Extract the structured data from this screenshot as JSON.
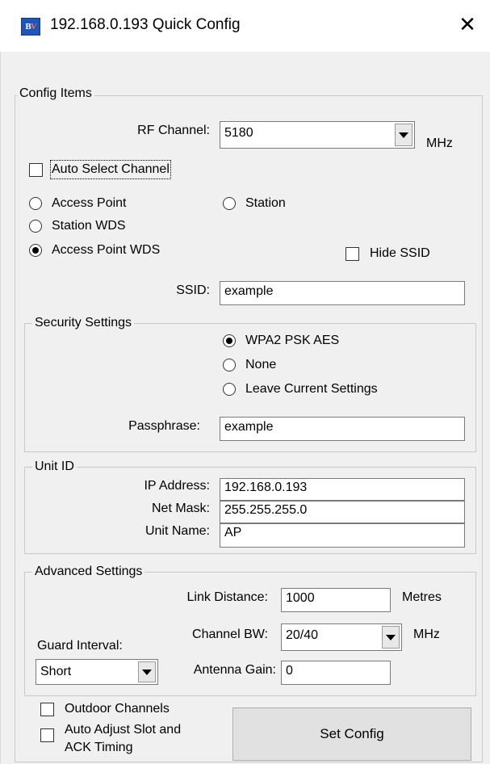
{
  "window": {
    "title": "192.168.0.193 Quick Config",
    "icon_name": "bv-app-icon",
    "icon_text_b": "B",
    "icon_text_v": "V",
    "close_glyph": "✕"
  },
  "config_items": {
    "legend": "Config Items",
    "rf_channel_label": "RF Channel:",
    "rf_channel_value": "5180",
    "rf_channel_unit": "MHz",
    "auto_select_label": "Auto Select Channel",
    "auto_select_checked": false,
    "modes": {
      "access_point": "Access Point",
      "station": "Station",
      "station_wds": "Station WDS",
      "access_point_wds": "Access Point WDS",
      "selected": "access_point_wds"
    },
    "hide_ssid_label": "Hide SSID",
    "hide_ssid_checked": false,
    "ssid_label": "SSID:",
    "ssid_value": "example"
  },
  "security": {
    "legend": "Security Settings",
    "options": {
      "wpa2": "WPA2 PSK AES",
      "none": "None",
      "leave": "Leave Current Settings",
      "selected": "wpa2"
    },
    "passphrase_label": "Passphrase:",
    "passphrase_value": "example"
  },
  "unit_id": {
    "legend": "Unit ID",
    "ip_label": "IP Address:",
    "ip_value": "192.168.0.193",
    "mask_label": "Net Mask:",
    "mask_value": "255.255.255.0",
    "name_label": "Unit Name:",
    "name_value": "AP"
  },
  "advanced": {
    "legend": "Advanced Settings",
    "link_distance_label": "Link Distance:",
    "link_distance_value": "1000",
    "link_distance_unit": "Metres",
    "channel_bw_label": "Channel BW:",
    "channel_bw_value": "20/40",
    "channel_bw_unit": "MHz",
    "guard_interval_label": "Guard Interval:",
    "guard_interval_value": "Short",
    "antenna_gain_label": "Antenna Gain:",
    "antenna_gain_value": "0"
  },
  "footer": {
    "outdoor_channels_label": "Outdoor Channels",
    "outdoor_channels_checked": false,
    "auto_adjust_label_line1": "Auto Adjust Slot and",
    "auto_adjust_label_line2": "ACK Timing",
    "auto_adjust_checked": false,
    "set_config_label": "Set Config"
  }
}
